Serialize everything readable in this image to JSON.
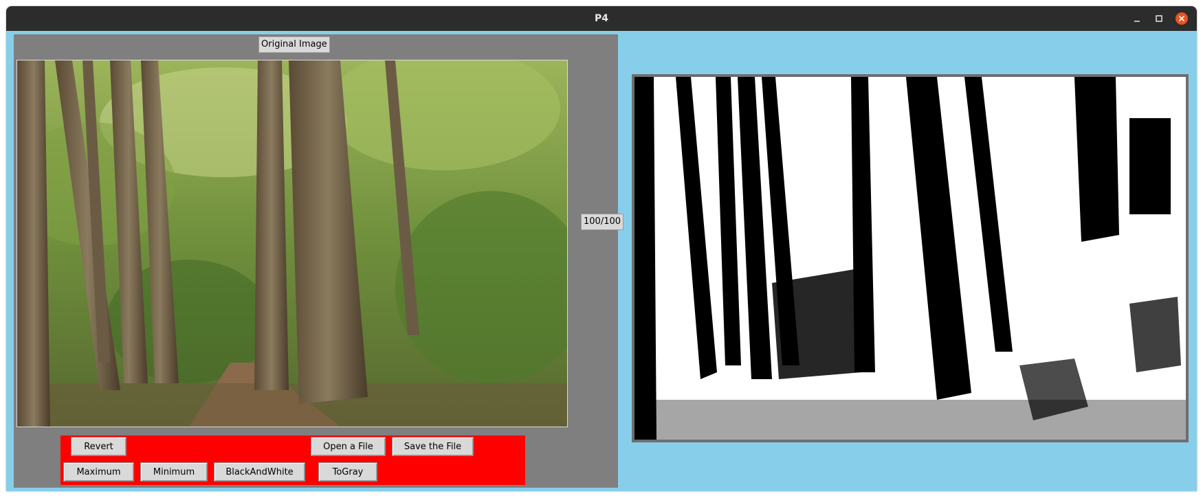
{
  "window": {
    "title": "P4"
  },
  "left_panel": {
    "original_label": "Original Image",
    "counter": "100/100"
  },
  "buttons": {
    "revert": "Revert",
    "open_file": "Open a File",
    "save_file": "Save the File",
    "maximum": "Maximum",
    "minimum": "Minimum",
    "black_and_white": "BlackAndWhite",
    "to_gray": "ToGray"
  },
  "icons": {
    "minimize": "minimize-icon",
    "maximize": "maximize-icon",
    "close": "close-icon"
  },
  "colors": {
    "titlebar": "#2c2c2c",
    "window_background": "#87ceeb",
    "panel_background": "#7f7f7f",
    "controls_background": "#ff0000",
    "close_button": "#e95420"
  }
}
